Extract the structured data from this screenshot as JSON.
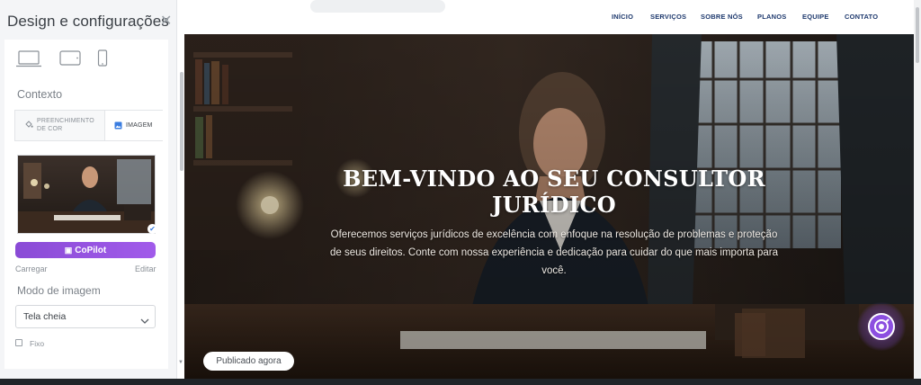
{
  "panel": {
    "title": "Design e configurações",
    "close_icon": "close-icon",
    "devices": [
      "desktop-icon",
      "tablet-icon",
      "mobile-icon"
    ],
    "context_label": "Contexto",
    "tabs": {
      "color_line1": "PREENCHIMENTO",
      "color_line2": "DE COR",
      "image": "IMAGEM"
    },
    "copilot_label": "CoPilot",
    "upload_link": "Carregar",
    "edit_link": "Editar",
    "image_mode_label": "Modo de imagem",
    "image_mode_value": "Tela cheia",
    "fixed_label": "Fixo",
    "fixed_checked": false,
    "accent_color": "#9a55e6"
  },
  "navbar": {
    "items": [
      "INÍCIO",
      "SERVIÇOS",
      "SOBRE NÓS",
      "PLANOS",
      "EQUIPE",
      "CONTATO"
    ],
    "text_color": "#1f3a6e"
  },
  "hero": {
    "title_line1": "BEM-VINDO AO SEU CONSULTOR",
    "title_line2": "JURÍDICO",
    "subtitle_line1": "Oferecemos serviços jurídicos de excelência com enfoque na resolução de problemas e proteção",
    "subtitle_line2": "de seus direitos. Conte com nossa experiência e dedicação para cuidar do que mais importa para",
    "subtitle_line3": "você.",
    "published_label": "Publicado agora",
    "fab_icon": "copilot-chat-icon"
  }
}
